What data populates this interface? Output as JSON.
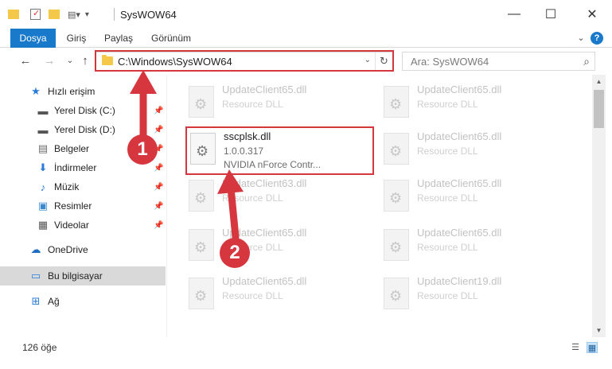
{
  "window": {
    "title": "SysWOW64",
    "minimize_glyph": "—",
    "maximize_glyph": "☐",
    "close_glyph": "✕"
  },
  "ribbon": {
    "tabs": [
      "Dosya",
      "Giriş",
      "Paylaş",
      "Görünüm"
    ],
    "expand_glyph": "⌄",
    "help_glyph": "?"
  },
  "nav": {
    "back_glyph": "←",
    "forward_glyph": "→",
    "recent_glyph": "⌄",
    "up_glyph": "↑",
    "address": "C:\\Windows\\SysWOW64",
    "address_drop_glyph": "⌄",
    "refresh_glyph": "↻",
    "search_placeholder": "Ara: SysWOW64",
    "search_glyph": "⌕"
  },
  "sidebar": {
    "items": [
      {
        "label": "Hızlı erişim",
        "icon": "star-icon",
        "glyph": "★",
        "color": "#2b7bd9",
        "pinned": false
      },
      {
        "label": "Yerel Disk (C:)",
        "icon": "drive-icon",
        "glyph": "▬",
        "color": "#555555",
        "pinned": true
      },
      {
        "label": "Yerel Disk (D:)",
        "icon": "drive-icon",
        "glyph": "▬",
        "color": "#555555",
        "pinned": true
      },
      {
        "label": "Belgeler",
        "icon": "documents-icon",
        "glyph": "▤",
        "color": "#6a6a6a",
        "pinned": true
      },
      {
        "label": "İndirmeler",
        "icon": "download-icon",
        "glyph": "⬇",
        "color": "#2b7bd9",
        "pinned": true
      },
      {
        "label": "Müzik",
        "icon": "music-icon",
        "glyph": "♪",
        "color": "#2b7bd9",
        "pinned": true
      },
      {
        "label": "Resimler",
        "icon": "pictures-icon",
        "glyph": "▣",
        "color": "#3b8ad0",
        "pinned": true
      },
      {
        "label": "Videolar",
        "icon": "videos-icon",
        "glyph": "▦",
        "color": "#555555",
        "pinned": true
      },
      {
        "label": "OneDrive",
        "icon": "cloud-icon",
        "glyph": "☁",
        "color": "#1f6fc4",
        "pinned": false
      },
      {
        "label": "Bu bilgisayar",
        "icon": "computer-icon",
        "glyph": "▭",
        "color": "#2b7bd9",
        "pinned": false
      },
      {
        "label": "Ağ",
        "icon": "network-icon",
        "glyph": "⊞",
        "color": "#2b7bd9",
        "pinned": false
      }
    ],
    "pin_glyph": "📌"
  },
  "files": [
    {
      "name": "UpdateClient65.dll",
      "desc": "Resource DLL"
    },
    {
      "name": "UpdateClient65.dll",
      "desc": "Resource DLL"
    },
    {
      "name": "UpdateClient65.dll",
      "desc": "Resource DLL"
    },
    {
      "name": "UpdateClient63.dll",
      "desc": "Resource DLL"
    },
    {
      "name": "UpdateClient65.dll",
      "desc": "Resource DLL"
    },
    {
      "name": "UpdateClient65.dll",
      "desc": "Resource DLL"
    },
    {
      "name": "UpdateClient65.dll",
      "desc": "Resource DLL"
    },
    {
      "name": "UpdateClient65.dll",
      "desc": "Resource DLL"
    },
    {
      "name": "UpdateClient19.dll",
      "desc": "Resource DLL"
    }
  ],
  "active_file": {
    "name": "sscplsk.dll",
    "version": "1.0.0.317",
    "desc": "NVIDIA nForce Contr..."
  },
  "status": {
    "count": "126 öğe",
    "details_glyph": "☰",
    "tiles_glyph": "▦"
  },
  "callouts": {
    "one": "1",
    "two": "2"
  },
  "colors": {
    "accent": "#1979ca",
    "highlight": "#d6373f"
  }
}
